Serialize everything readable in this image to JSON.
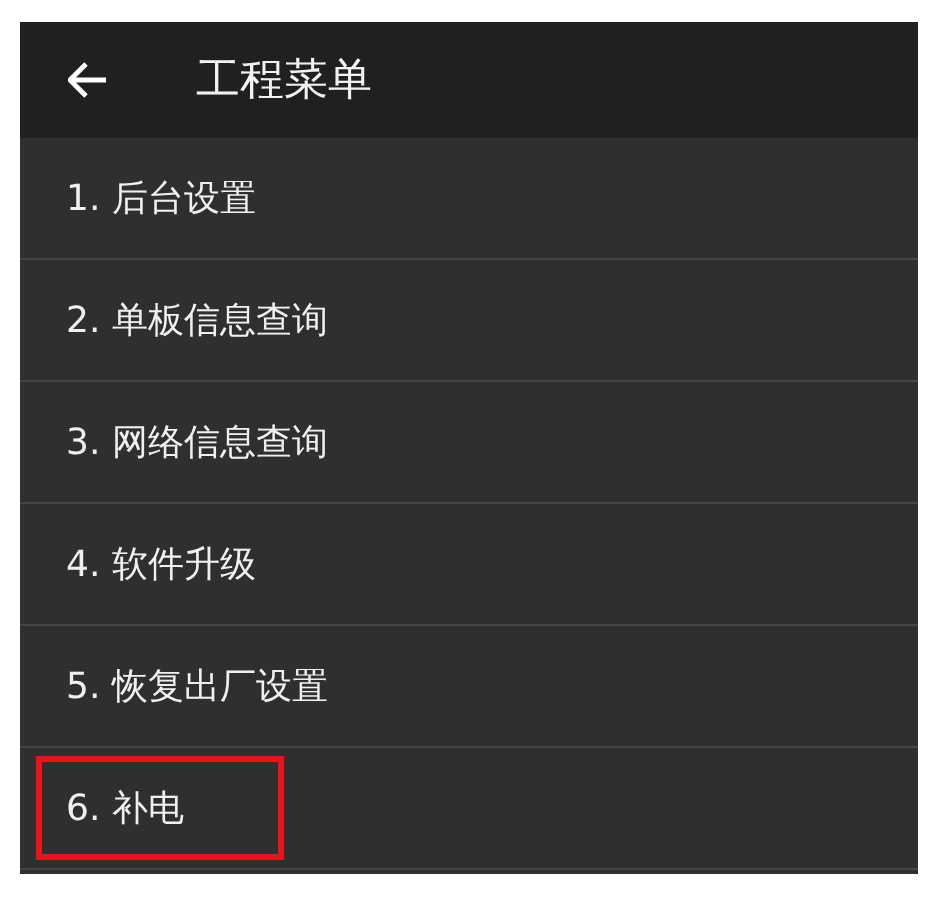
{
  "header": {
    "title": "工程菜单"
  },
  "menu_items": [
    {
      "label": "1. 后台设置",
      "highlighted": false
    },
    {
      "label": "2. 单板信息查询",
      "highlighted": false
    },
    {
      "label": "3. 网络信息查询",
      "highlighted": false
    },
    {
      "label": "4. 软件升级",
      "highlighted": false
    },
    {
      "label": "5. 恢复出厂设置",
      "highlighted": false
    },
    {
      "label": "6. 补电",
      "highlighted": true
    }
  ]
}
